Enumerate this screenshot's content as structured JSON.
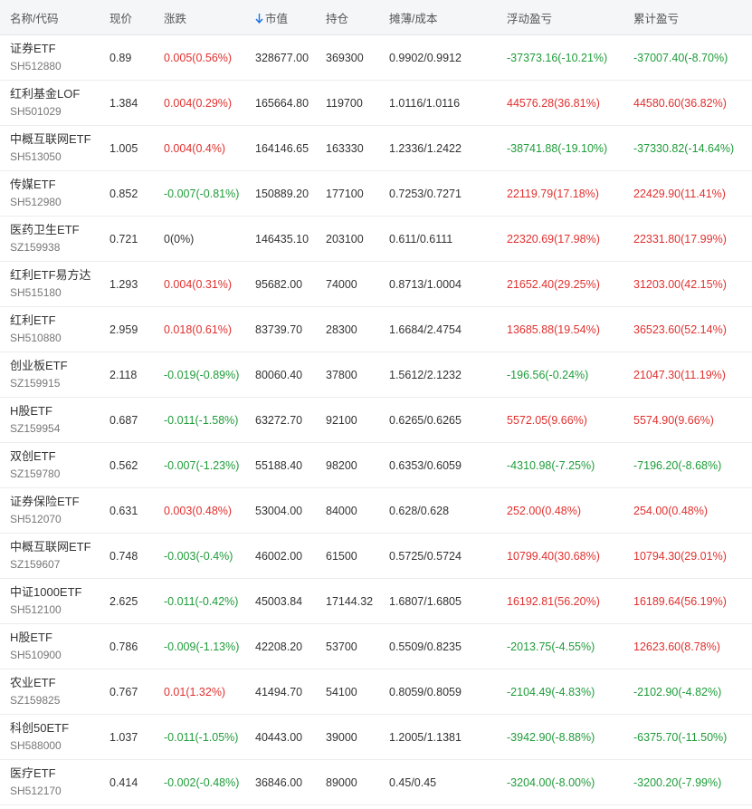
{
  "colors": {
    "up": "#e0312f",
    "down": "#1f9c3a",
    "accent": "#1a73e8",
    "header_bg": "#f5f6f8"
  },
  "table": {
    "sort_icon": "arrow-down-icon",
    "headers": {
      "name_code": "名称/代码",
      "price": "现价",
      "change": "涨跌",
      "market_value": "市值",
      "position": "持仓",
      "cost": "摊薄/成本",
      "float_pl": "浮动盈亏",
      "total_pl": "累计盈亏"
    },
    "rows": [
      {
        "name": "证券ETF",
        "code": "SH512880",
        "price": "0.89",
        "change": "0.005(0.56%)",
        "change_dir": "up",
        "market_value": "328677.00",
        "position": "369300",
        "cost": "0.9902/0.9912",
        "float_pl": "-37373.16(-10.21%)",
        "float_dir": "down",
        "total_pl": "-37007.40(-8.70%)",
        "total_dir": "down"
      },
      {
        "name": "红利基金LOF",
        "code": "SH501029",
        "price": "1.384",
        "change": "0.004(0.29%)",
        "change_dir": "up",
        "market_value": "165664.80",
        "position": "119700",
        "cost": "1.0116/1.0116",
        "float_pl": "44576.28(36.81%)",
        "float_dir": "up",
        "total_pl": "44580.60(36.82%)",
        "total_dir": "up"
      },
      {
        "name": "中概互联网ETF",
        "code": "SH513050",
        "price": "1.005",
        "change": "0.004(0.4%)",
        "change_dir": "up",
        "market_value": "164146.65",
        "position": "163330",
        "cost": "1.2336/1.2422",
        "float_pl": "-38741.88(-19.10%)",
        "float_dir": "down",
        "total_pl": "-37330.82(-14.64%)",
        "total_dir": "down"
      },
      {
        "name": "传媒ETF",
        "code": "SH512980",
        "price": "0.852",
        "change": "-0.007(-0.81%)",
        "change_dir": "down",
        "market_value": "150889.20",
        "position": "177100",
        "cost": "0.7253/0.7271",
        "float_pl": "22119.79(17.18%)",
        "float_dir": "up",
        "total_pl": "22429.90(11.41%)",
        "total_dir": "up"
      },
      {
        "name": "医药卫生ETF",
        "code": "SZ159938",
        "price": "0.721",
        "change": "0(0%)",
        "change_dir": "flat",
        "market_value": "146435.10",
        "position": "203100",
        "cost": "0.611/0.6111",
        "float_pl": "22320.69(17.98%)",
        "float_dir": "up",
        "total_pl": "22331.80(17.99%)",
        "total_dir": "up"
      },
      {
        "name": "红利ETF易方达",
        "code": "SH515180",
        "price": "1.293",
        "change": "0.004(0.31%)",
        "change_dir": "up",
        "market_value": "95682.00",
        "position": "74000",
        "cost": "0.8713/1.0004",
        "float_pl": "21652.40(29.25%)",
        "float_dir": "up",
        "total_pl": "31203.00(42.15%)",
        "total_dir": "up"
      },
      {
        "name": "红利ETF",
        "code": "SH510880",
        "price": "2.959",
        "change": "0.018(0.61%)",
        "change_dir": "up",
        "market_value": "83739.70",
        "position": "28300",
        "cost": "1.6684/2.4754",
        "float_pl": "13685.88(19.54%)",
        "float_dir": "up",
        "total_pl": "36523.60(52.14%)",
        "total_dir": "up"
      },
      {
        "name": "创业板ETF",
        "code": "SZ159915",
        "price": "2.118",
        "change": "-0.019(-0.89%)",
        "change_dir": "down",
        "market_value": "80060.40",
        "position": "37800",
        "cost": "1.5612/2.1232",
        "float_pl": "-196.56(-0.24%)",
        "float_dir": "down",
        "total_pl": "21047.30(11.19%)",
        "total_dir": "up"
      },
      {
        "name": "H股ETF",
        "code": "SZ159954",
        "price": "0.687",
        "change": "-0.011(-1.58%)",
        "change_dir": "down",
        "market_value": "63272.70",
        "position": "92100",
        "cost": "0.6265/0.6265",
        "float_pl": "5572.05(9.66%)",
        "float_dir": "up",
        "total_pl": "5574.90(9.66%)",
        "total_dir": "up"
      },
      {
        "name": "双创ETF",
        "code": "SZ159780",
        "price": "0.562",
        "change": "-0.007(-1.23%)",
        "change_dir": "down",
        "market_value": "55188.40",
        "position": "98200",
        "cost": "0.6353/0.6059",
        "float_pl": "-4310.98(-7.25%)",
        "float_dir": "down",
        "total_pl": "-7196.20(-8.68%)",
        "total_dir": "down"
      },
      {
        "name": "证券保险ETF",
        "code": "SH512070",
        "price": "0.631",
        "change": "0.003(0.48%)",
        "change_dir": "up",
        "market_value": "53004.00",
        "position": "84000",
        "cost": "0.628/0.628",
        "float_pl": "252.00(0.48%)",
        "float_dir": "up",
        "total_pl": "254.00(0.48%)",
        "total_dir": "up"
      },
      {
        "name": "中概互联网ETF",
        "code": "SZ159607",
        "price": "0.748",
        "change": "-0.003(-0.4%)",
        "change_dir": "down",
        "market_value": "46002.00",
        "position": "61500",
        "cost": "0.5725/0.5724",
        "float_pl": "10799.40(30.68%)",
        "float_dir": "up",
        "total_pl": "10794.30(29.01%)",
        "total_dir": "up"
      },
      {
        "name": "中证1000ETF",
        "code": "SH512100",
        "price": "2.625",
        "change": "-0.011(-0.42%)",
        "change_dir": "down",
        "market_value": "45003.84",
        "position": "17144.32",
        "cost": "1.6807/1.6805",
        "float_pl": "16192.81(56.20%)",
        "float_dir": "up",
        "total_pl": "16189.64(56.19%)",
        "total_dir": "up"
      },
      {
        "name": "H股ETF",
        "code": "SH510900",
        "price": "0.786",
        "change": "-0.009(-1.13%)",
        "change_dir": "down",
        "market_value": "42208.20",
        "position": "53700",
        "cost": "0.5509/0.8235",
        "float_pl": "-2013.75(-4.55%)",
        "float_dir": "down",
        "total_pl": "12623.60(8.78%)",
        "total_dir": "up"
      },
      {
        "name": "农业ETF",
        "code": "SZ159825",
        "price": "0.767",
        "change": "0.01(1.32%)",
        "change_dir": "up",
        "market_value": "41494.70",
        "position": "54100",
        "cost": "0.8059/0.8059",
        "float_pl": "-2104.49(-4.83%)",
        "float_dir": "down",
        "total_pl": "-2102.90(-4.82%)",
        "total_dir": "down"
      },
      {
        "name": "科创50ETF",
        "code": "SH588000",
        "price": "1.037",
        "change": "-0.011(-1.05%)",
        "change_dir": "down",
        "market_value": "40443.00",
        "position": "39000",
        "cost": "1.2005/1.1381",
        "float_pl": "-3942.90(-8.88%)",
        "float_dir": "down",
        "total_pl": "-6375.70(-11.50%)",
        "total_dir": "down"
      },
      {
        "name": "医疗ETF",
        "code": "SH512170",
        "price": "0.414",
        "change": "-0.002(-0.48%)",
        "change_dir": "down",
        "market_value": "36846.00",
        "position": "89000",
        "cost": "0.45/0.45",
        "float_pl": "-3204.00(-8.00%)",
        "float_dir": "down",
        "total_pl": "-3200.20(-7.99%)",
        "total_dir": "down"
      }
    ]
  }
}
